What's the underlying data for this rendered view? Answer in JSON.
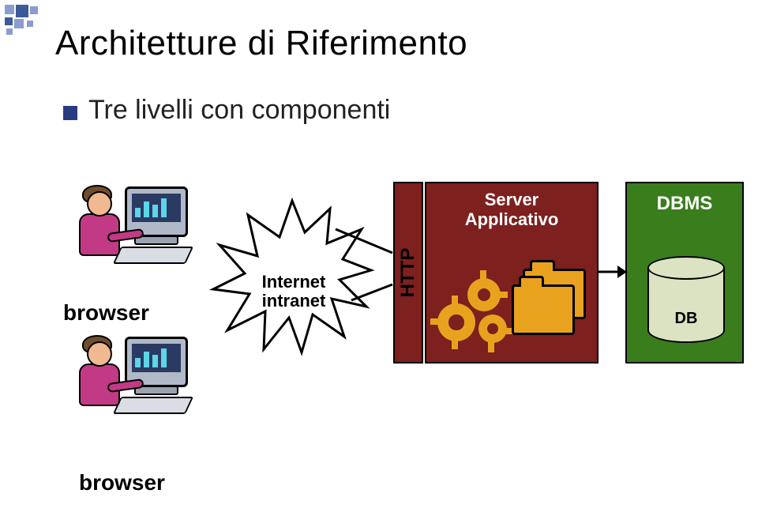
{
  "title": "Architetture di Riferimento",
  "bullet": "Tre livelli con componenti",
  "labels": {
    "browser": "browser",
    "network_line1": "Internet",
    "network_line2": "intranet",
    "http": "HTTP",
    "app_server_line1": "Server",
    "app_server_line2": "Applicativo",
    "dbms": "DBMS",
    "db": "DB"
  },
  "colors": {
    "title_accent": "#2a3c80",
    "server_box": "#7d201e",
    "server_gear": "#e9a21e",
    "dbms_box": "#3a7d1d",
    "db_cylinder": "#dbe3c2",
    "corner_light": "#8b9ccf",
    "corner_dark": "#3e5b99"
  },
  "diagram": {
    "tiers": 3,
    "components": [
      {
        "role": "client",
        "name": "browser",
        "count": 2
      },
      {
        "role": "network",
        "name": "Internet / intranet",
        "protocol": "HTTP"
      },
      {
        "role": "application",
        "name": "Server Applicativo",
        "parts": [
          "process-gears",
          "file-folders"
        ]
      },
      {
        "role": "data",
        "name": "DBMS",
        "store": "DB"
      }
    ],
    "edges": [
      {
        "from": "browser",
        "to": "Internet / intranet"
      },
      {
        "from": "Internet / intranet",
        "to": "Server Applicativo",
        "protocol": "HTTP"
      },
      {
        "from": "Server Applicativo",
        "to": "DBMS"
      }
    ]
  }
}
